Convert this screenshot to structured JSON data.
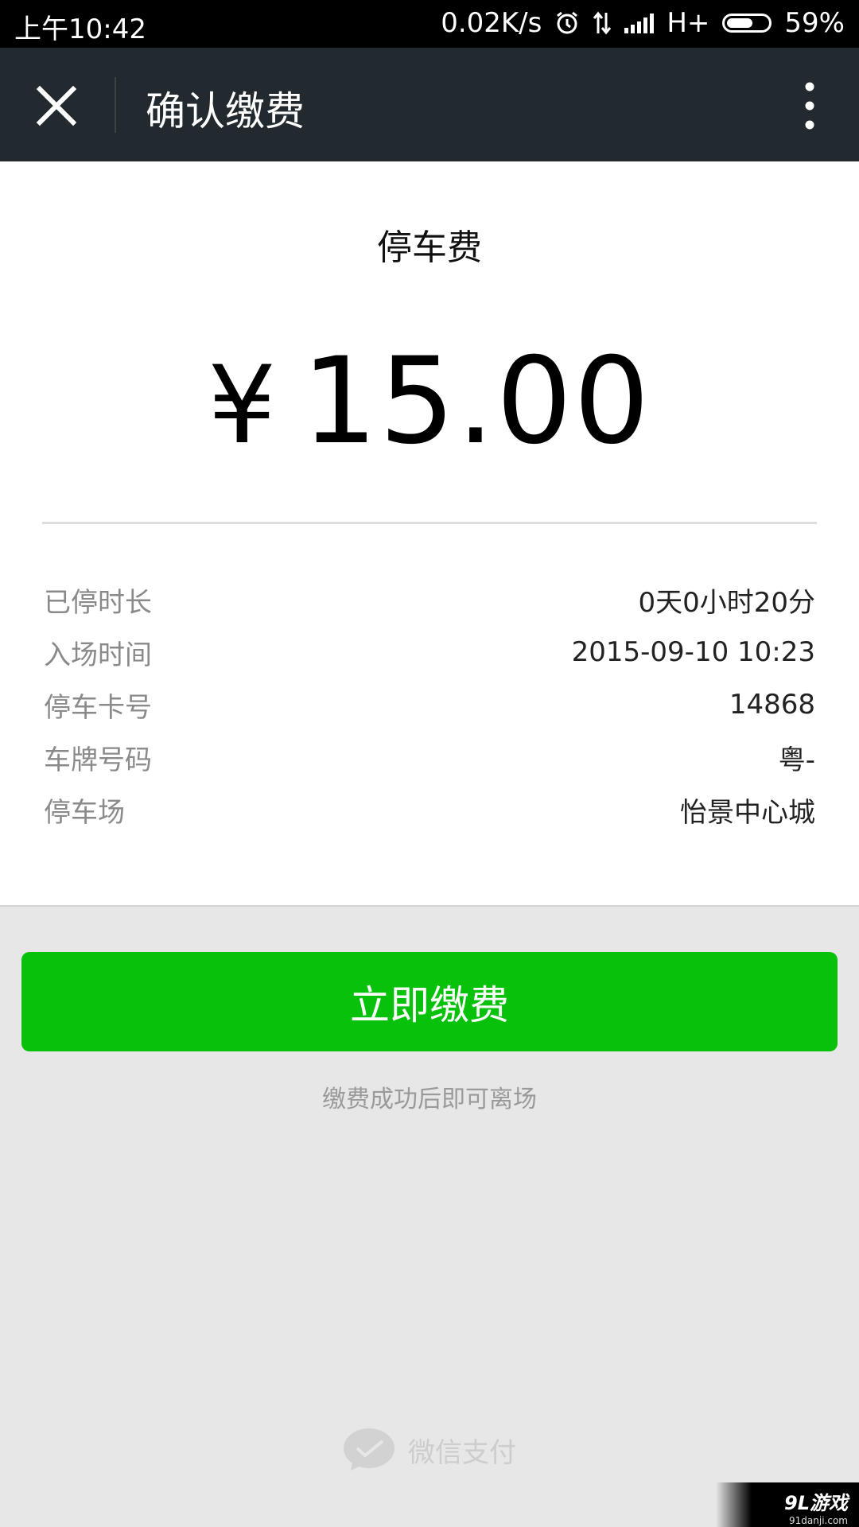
{
  "status_bar": {
    "time": "上午10:42",
    "speed": "0.02K/s",
    "network": "H+",
    "battery": "59%"
  },
  "header": {
    "title": "确认缴费"
  },
  "fee": {
    "title": "停车费",
    "currency": "¥",
    "amount": "15.00"
  },
  "info": [
    {
      "label": "已停时长",
      "value": "0天0小时20分"
    },
    {
      "label": "入场时间",
      "value": "2015-09-10 10:23"
    },
    {
      "label": "停车卡号",
      "value": "14868"
    },
    {
      "label": "车牌号码",
      "value": "粤-"
    },
    {
      "label": "停车场",
      "value": "怡景中心城"
    }
  ],
  "pay_button": "立即缴费",
  "hint": "缴费成功后即可离场",
  "footer": {
    "brand": "微信支付"
  },
  "watermark": {
    "logo": "9L游戏",
    "site": "91danji.com"
  },
  "colors": {
    "accent_green": "#07c10a",
    "header_bg": "#232a2f",
    "page_bg": "#e6e7e6"
  }
}
